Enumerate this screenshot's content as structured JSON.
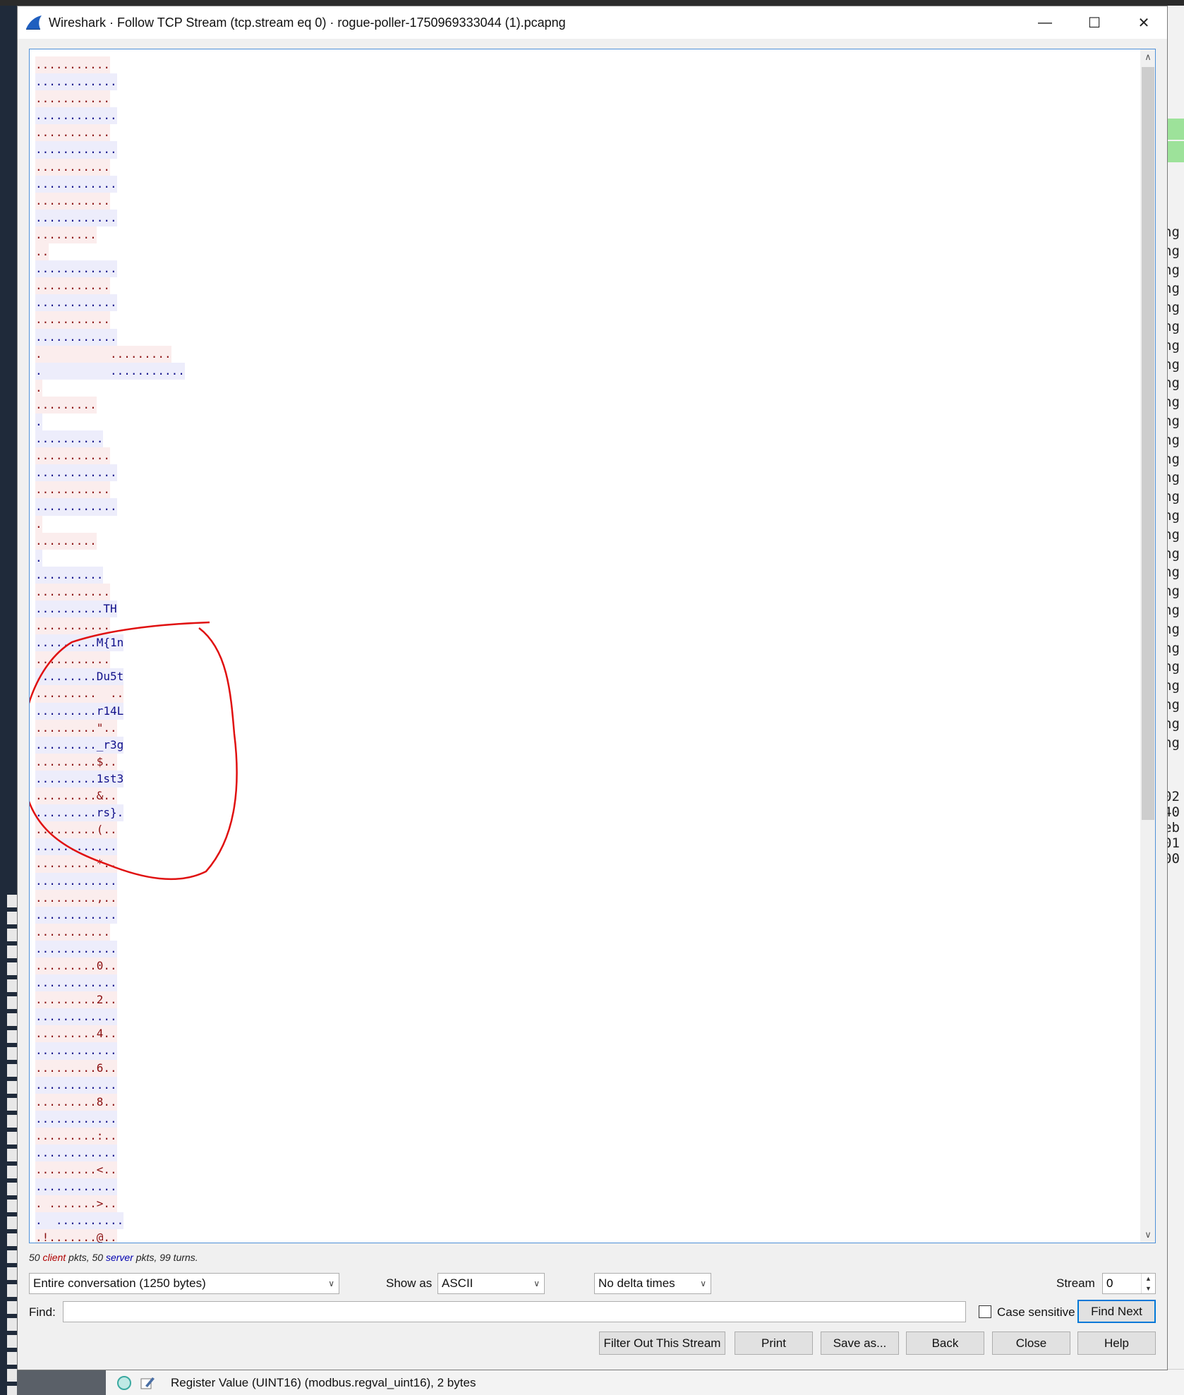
{
  "window": {
    "title": "Wireshark · Follow TCP Stream (tcp.stream eq 0) · rogue-poller-1750969333044 (1).pcapng",
    "minimize_glyph": "—",
    "maximize_glyph": "☐",
    "close_glyph": "✕"
  },
  "stream_lines": [
    {
      "dir": "client",
      "text": "..........."
    },
    {
      "dir": "server",
      "text": "............"
    },
    {
      "dir": "client",
      "text": "..........."
    },
    {
      "dir": "server",
      "text": "............"
    },
    {
      "dir": "client",
      "text": "..........."
    },
    {
      "dir": "server",
      "text": "............"
    },
    {
      "dir": "client",
      "text": "..........."
    },
    {
      "dir": "server",
      "text": "............"
    },
    {
      "dir": "client",
      "text": "..........."
    },
    {
      "dir": "server",
      "text": "............"
    },
    {
      "dir": "client",
      "text": "........."
    },
    {
      "dir": "client",
      "text": ".."
    },
    {
      "dir": "server",
      "text": "............"
    },
    {
      "dir": "client",
      "text": "..........."
    },
    {
      "dir": "server",
      "text": "............"
    },
    {
      "dir": "client",
      "text": "..........."
    },
    {
      "dir": "server",
      "text": "............"
    },
    {
      "dir": "client",
      "text": ".          ........."
    },
    {
      "dir": "server",
      "text": ".          ..........."
    },
    {
      "dir": "client",
      "text": "."
    },
    {
      "dir": "client",
      "text": "........."
    },
    {
      "dir": "server",
      "text": "."
    },
    {
      "dir": "server",
      "text": ".........."
    },
    {
      "dir": "client",
      "text": "..........."
    },
    {
      "dir": "server",
      "text": "............"
    },
    {
      "dir": "client",
      "text": "..........."
    },
    {
      "dir": "server",
      "text": "............"
    },
    {
      "dir": "client",
      "text": "."
    },
    {
      "dir": "client",
      "text": "........."
    },
    {
      "dir": "server",
      "text": "."
    },
    {
      "dir": "server",
      "text": ".........."
    },
    {
      "dir": "client",
      "text": "..........."
    },
    {
      "dir": "server",
      "text": "..........TH"
    },
    {
      "dir": "client",
      "text": "..........."
    },
    {
      "dir": "server",
      "text": ".........M{1n"
    },
    {
      "dir": "client",
      "text": "..........."
    },
    {
      "dir": "server",
      "text": ".........Du5t"
    },
    {
      "dir": "client",
      "text": ".........  .."
    },
    {
      "dir": "server",
      "text": ".........r14L"
    },
    {
      "dir": "client",
      "text": ".........\".."
    },
    {
      "dir": "server",
      "text": "........._r3g"
    },
    {
      "dir": "client",
      "text": ".........$.."
    },
    {
      "dir": "server",
      "text": ".........1st3"
    },
    {
      "dir": "client",
      "text": ".........&.."
    },
    {
      "dir": "server",
      "text": ".........rs}."
    },
    {
      "dir": "client",
      "text": ".........(.."
    },
    {
      "dir": "server",
      "text": "............"
    },
    {
      "dir": "client",
      "text": ".........*.."
    },
    {
      "dir": "server",
      "text": "............"
    },
    {
      "dir": "client",
      "text": ".........,.."
    },
    {
      "dir": "server",
      "text": "............"
    },
    {
      "dir": "client",
      "text": "..........."
    },
    {
      "dir": "server",
      "text": "............"
    },
    {
      "dir": "client",
      "text": ".........0.."
    },
    {
      "dir": "server",
      "text": "............"
    },
    {
      "dir": "client",
      "text": ".........2.."
    },
    {
      "dir": "server",
      "text": "............"
    },
    {
      "dir": "client",
      "text": ".........4.."
    },
    {
      "dir": "server",
      "text": "............"
    },
    {
      "dir": "client",
      "text": ".........6.."
    },
    {
      "dir": "server",
      "text": "............"
    },
    {
      "dir": "client",
      "text": ".........8.."
    },
    {
      "dir": "server",
      "text": "............"
    },
    {
      "dir": "client",
      "text": ".........:.."
    },
    {
      "dir": "server",
      "text": "............"
    },
    {
      "dir": "client",
      "text": ".........<.."
    },
    {
      "dir": "server",
      "text": "............"
    },
    {
      "dir": "client",
      "text": ". .......>.."
    },
    {
      "dir": "server",
      "text": ".  .........."
    },
    {
      "dir": "client",
      "text": ".!.......@.."
    },
    {
      "dir": "server",
      "text": "............"
    }
  ],
  "stats": {
    "prefix": "50 ",
    "client_word": "client",
    "middle": " pkts, 50 ",
    "server_word": "server",
    "suffix": " pkts, 99 turns."
  },
  "controls": {
    "conversation_select": "Entire conversation (1250 bytes)",
    "show_as_label": "Show as",
    "show_as_select": "ASCII",
    "delta_select": "No delta times",
    "stream_label": "Stream",
    "stream_value": "0",
    "find_label": "Find:",
    "find_value": "",
    "case_sensitive_label": "Case sensitive",
    "find_next_button": "Find Next"
  },
  "buttons": {
    "filter_out": "Filter Out This Stream",
    "print": "Print",
    "save_as": "Save as...",
    "back": "Back",
    "close": "Close",
    "help": "Help"
  },
  "statusbar": {
    "text": "Register Value (UINT16) (modbus.regval_uint16), 2 bytes"
  },
  "background_fragments": {
    "right_column": [
      "ng",
      "ng",
      "ng",
      "ng",
      "ng",
      "ng",
      "ng",
      "ng",
      "ng",
      "ng",
      "ng",
      "ng",
      "ng",
      "ng",
      "ng",
      "ng",
      "ng",
      "ng",
      "ng",
      "ng",
      "ng",
      "ng",
      "ng",
      "ng",
      "ng",
      "ng",
      "ng",
      "ng"
    ],
    "right_hex": [
      "02",
      "40",
      "eb",
      "01",
      "00"
    ]
  },
  "colors": {
    "client_bg": "#fbeded",
    "client_fg": "#8a1010",
    "server_bg": "#ededfb",
    "server_fg": "#10108a",
    "annotation": "#e01010",
    "focus": "#0078d7"
  }
}
